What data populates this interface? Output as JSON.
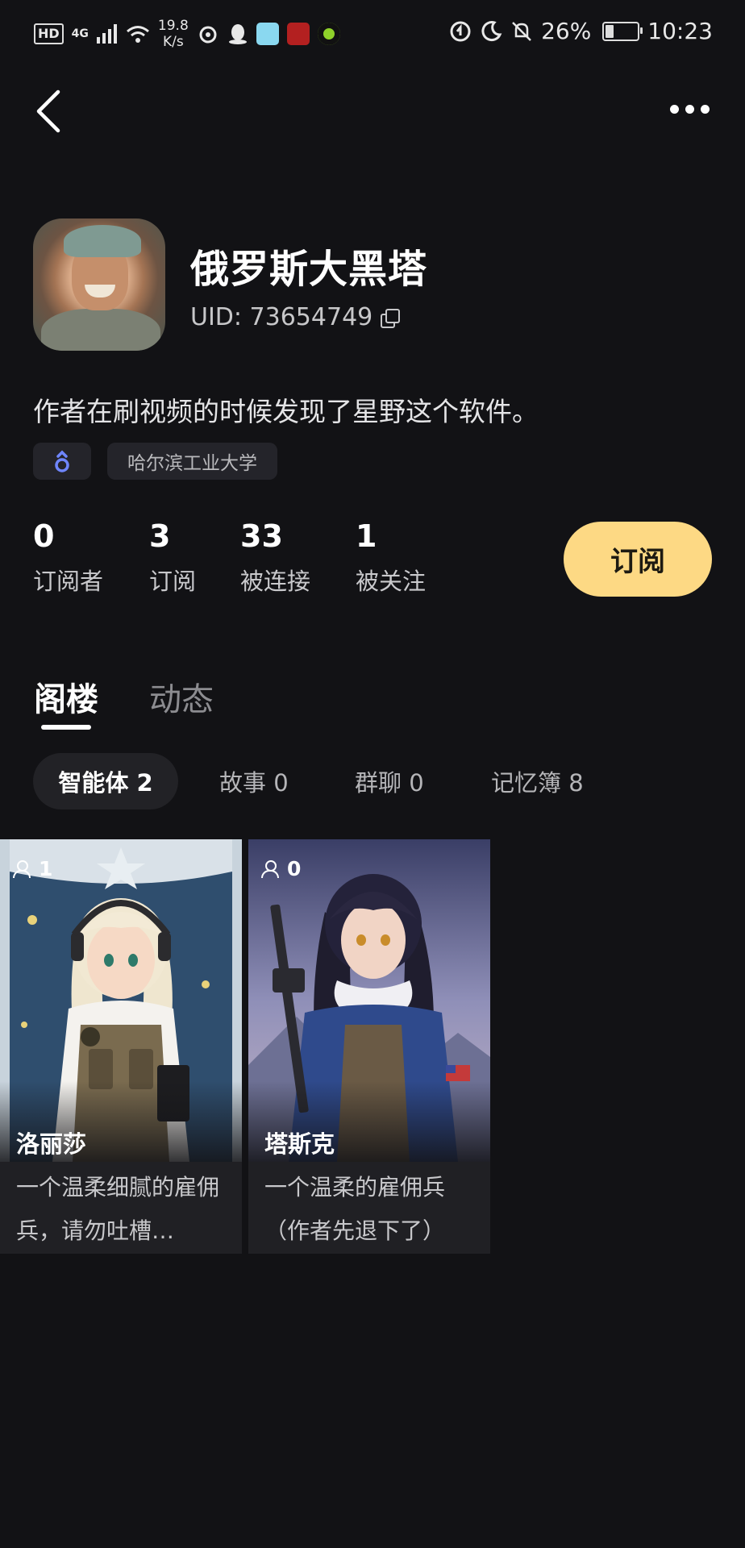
{
  "status_bar": {
    "network": "HD",
    "signal": "4G",
    "speed": "19.8",
    "speed_unit": "K/s",
    "battery": "26%",
    "battery_level": 0.26,
    "time": "10:23"
  },
  "profile": {
    "name": "俄罗斯大黑塔",
    "uid": "UID: 73654749",
    "bio": "作者在刷视频的时候发现了星野这个软件。",
    "tags": [
      "哈尔滨工业大学"
    ]
  },
  "stats": [
    {
      "value": "0",
      "label": "订阅者"
    },
    {
      "value": "3",
      "label": "订阅"
    },
    {
      "value": "33",
      "label": "被连接"
    },
    {
      "value": "1",
      "label": "被关注"
    }
  ],
  "subscribe_label": "订阅",
  "tabs": [
    {
      "label": "阁楼"
    },
    {
      "label": "动态"
    }
  ],
  "chips": [
    {
      "label": "智能体 2"
    },
    {
      "label": "故事 0"
    },
    {
      "label": "群聊 0"
    },
    {
      "label": "记忆簿 8"
    }
  ],
  "cards": [
    {
      "count": "1",
      "title": "洛丽莎",
      "desc": "一个温柔细腻的雇佣兵，请勿吐槽…"
    },
    {
      "count": "0",
      "title": "塔斯克",
      "desc": "一个温柔的雇佣兵（作者先退下了）"
    }
  ]
}
